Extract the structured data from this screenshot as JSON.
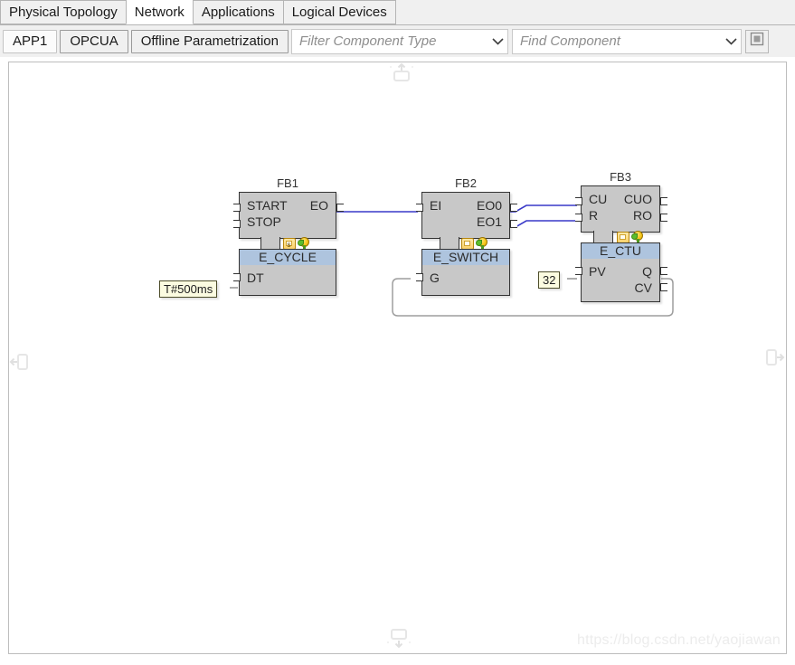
{
  "window": {
    "tabs": [
      {
        "label": "Physical Topology",
        "active": false
      },
      {
        "label": "Network",
        "active": true
      },
      {
        "label": "Applications",
        "active": false
      },
      {
        "label": "Logical Devices",
        "active": false
      }
    ]
  },
  "toolbar": {
    "app_button": "APP1",
    "opcua_button": "OPCUA",
    "offline_button": "Offline Parametrization",
    "filter_placeholder": "Filter Component Type",
    "find_placeholder": "Find Component",
    "zoom_fit_icon": "fit-to-window-icon",
    "chevron_icon": "chevron-down-icon"
  },
  "canvas": {
    "watermark": "https://blog.csdn.net/yaojiawan",
    "edge_handles": [
      {
        "name": "canvas-handle-top",
        "icon": "collapse-up-icon"
      },
      {
        "name": "canvas-handle-left",
        "icon": "collapse-left-icon"
      },
      {
        "name": "canvas-handle-right",
        "icon": "collapse-right-icon"
      },
      {
        "name": "canvas-handle-bottom",
        "icon": "collapse-down-icon"
      }
    ],
    "blocks": [
      {
        "id": "fb1",
        "name": "FB1",
        "type": "E_CYCLE",
        "event_inputs": [
          "START",
          "STOP"
        ],
        "event_outputs": [
          "EO"
        ],
        "data_inputs": [
          "DT"
        ],
        "data_outputs": [],
        "icons": [
          "service-sequence-icon",
          "idea-icon"
        ]
      },
      {
        "id": "fb2",
        "name": "FB2",
        "type": "E_SWITCH",
        "event_inputs": [
          "EI"
        ],
        "event_outputs": [
          "EO0",
          "EO1"
        ],
        "data_inputs": [
          "G"
        ],
        "data_outputs": [],
        "icons": [
          "window-icon",
          "idea-icon"
        ]
      },
      {
        "id": "fb3",
        "name": "FB3",
        "type": "E_CTU",
        "event_inputs": [
          "CU",
          "R"
        ],
        "event_outputs": [
          "CUO",
          "RO"
        ],
        "data_inputs": [
          "PV"
        ],
        "data_outputs": [
          "Q",
          "CV"
        ],
        "icons": [
          "window-icon",
          "idea-icon"
        ]
      }
    ],
    "literals": [
      {
        "id": "lit-dt",
        "value": "T#500ms",
        "target": "FB1.DT"
      },
      {
        "id": "lit-pv",
        "value": "32",
        "target": "FB3.PV"
      }
    ],
    "connections": [
      {
        "from": "FB1.EO",
        "to": "FB2.EI",
        "kind": "event"
      },
      {
        "from": "FB2.EO0",
        "to": "FB3.CU",
        "kind": "event"
      },
      {
        "from": "FB2.EO1",
        "to": "FB3.R",
        "kind": "event"
      },
      {
        "from": "FB3.Q",
        "to": "FB2.G",
        "kind": "data"
      }
    ],
    "colors": {
      "block_body": "#c8c8c8",
      "block_title": "#aec4de",
      "event_wire": "#3838c8",
      "data_wire": "#9a9a9a",
      "literal_bg": "#fbfbe0"
    }
  }
}
